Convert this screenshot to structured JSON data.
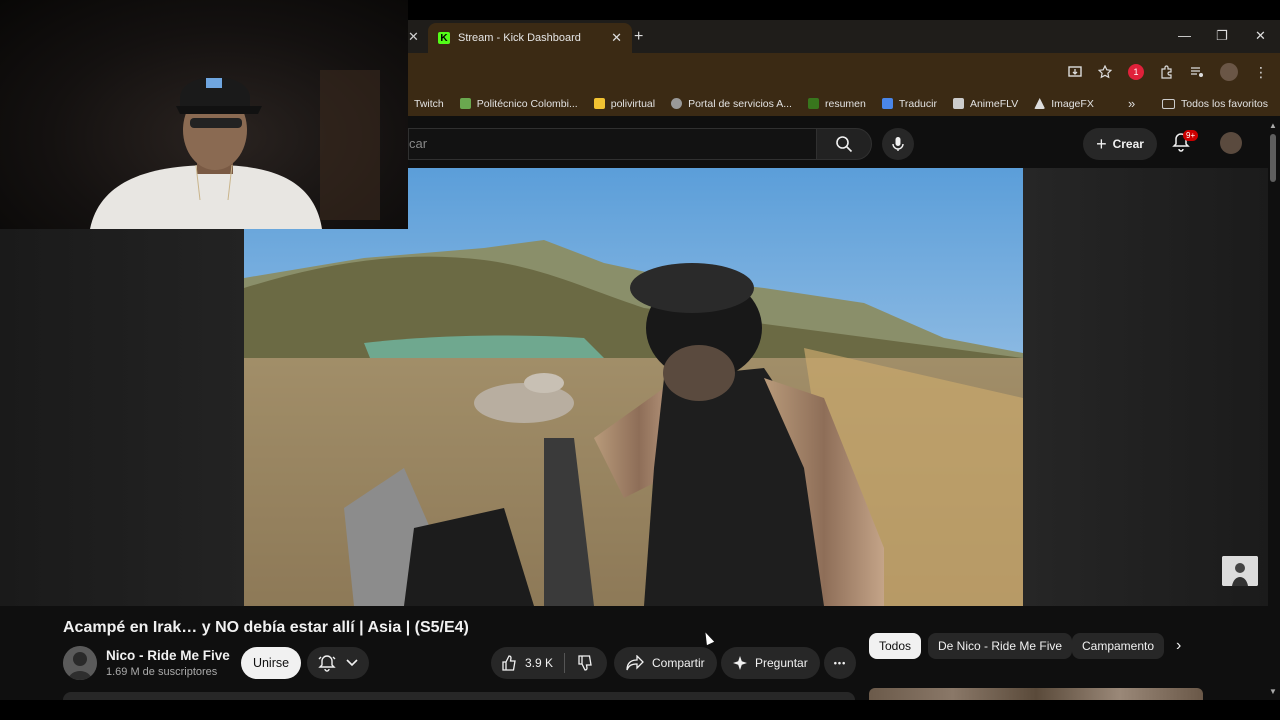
{
  "browser": {
    "tab_title": "Stream - Kick Dashboard",
    "tab_favicon": "K",
    "new_tab": "+",
    "close": "✕",
    "window_controls": [
      "—",
      "❐",
      "✕"
    ],
    "extension_badge": "1"
  },
  "bookmarks": [
    {
      "label": "Twitch",
      "color": "#9146ff"
    },
    {
      "label": "Politécnico Colombi...",
      "color": "#6aa84f"
    },
    {
      "label": "polivirtual",
      "color": "#f1c232"
    },
    {
      "label": "Portal de servicios A...",
      "color": "#999999"
    },
    {
      "label": "resumen",
      "color": "#38761d"
    },
    {
      "label": "Traducir",
      "color": "#4a86e8"
    },
    {
      "label": "AnimeFLV",
      "color": "#cccccc"
    },
    {
      "label": "ImageFX",
      "color": "#dddddd"
    }
  ],
  "bookmarks_more": "»",
  "bookmarks_all": "Todos los favoritos",
  "youtube": {
    "search_placeholder": "car",
    "create_label": "Crear",
    "notifications": "9+"
  },
  "video": {
    "title": "Acampé en Irak… y NO debía estar allí | Asia | (S5/E4)",
    "channel": "Nico - Ride Me Five",
    "subscribers": "1.69 M de suscriptores",
    "join_label": "Unirse",
    "likes": "3.9 K",
    "share_label": "Compartir",
    "ask_label": "Preguntar",
    "more": "•••"
  },
  "chips": [
    {
      "label": "Todos",
      "active": true
    },
    {
      "label": "De Nico - Ride Me Five",
      "active": false
    },
    {
      "label": "Campamento",
      "active": false
    }
  ],
  "chips_next": "›"
}
